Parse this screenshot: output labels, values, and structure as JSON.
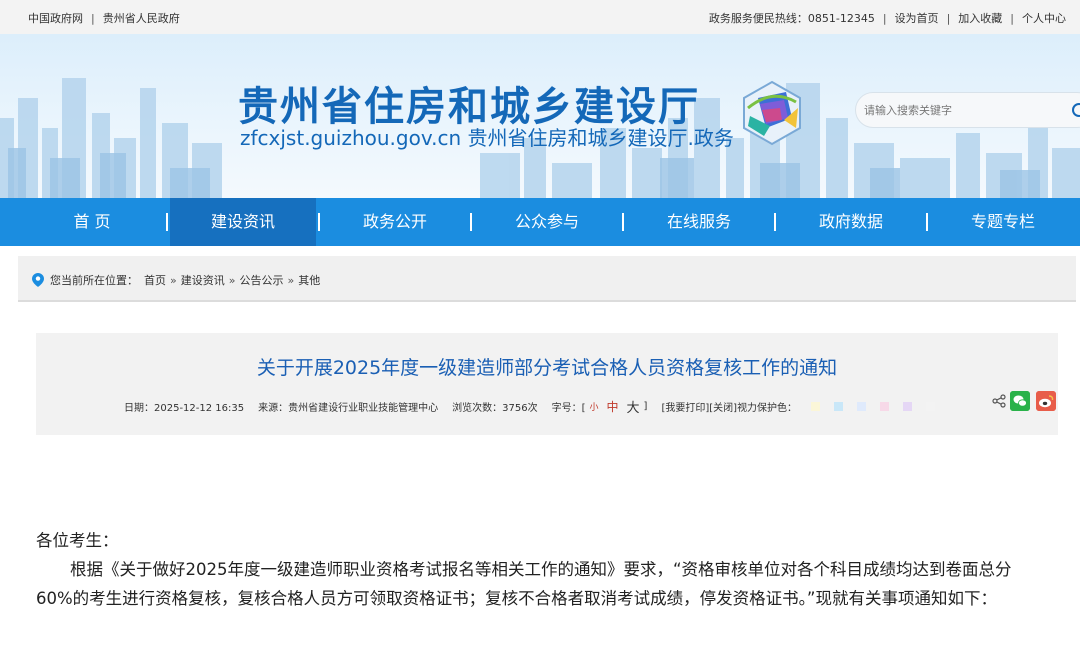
{
  "topbar": {
    "links_left": [
      "中国政府网",
      "贵州省人民政府"
    ],
    "hotline_label": "政务服务便民热线：",
    "hotline_number": "0851-12345",
    "links_right": [
      "设为首页",
      "加入收藏",
      "个人中心"
    ]
  },
  "banner": {
    "title": "贵州省住房和城乡建设厅",
    "subtitle": "zfcxjst.guizhou.gov.cn 贵州省住房和城乡建设厅.政务"
  },
  "search": {
    "placeholder": "请输入搜索关键字"
  },
  "nav": {
    "items": [
      "首 页",
      "建设资讯",
      "政务公开",
      "公众参与",
      "在线服务",
      "政府数据",
      "专题专栏"
    ],
    "active_index": 1
  },
  "breadcrumb": {
    "label": "您当前所在位置：",
    "items": [
      "首页",
      "建设资讯",
      "公告公示",
      "其他"
    ]
  },
  "article": {
    "title": "关于开展2025年度一级建造师部分考试合格人员资格复核工作的通知",
    "date": "日期：2025-12-12 16:35",
    "source": "来源：贵州省建设行业职业技能管理中心",
    "views": "浏览次数：3756次",
    "font_size_label": "字号：[",
    "font_small": "小",
    "font_medium": "中",
    "font_large": "大",
    "font_size_close": "]",
    "print": "[我要打印]",
    "close": "[关闭]",
    "eye_care": "视力保护色：",
    "eye_colors": [
      "#fbf6d8",
      "#c9e7f8",
      "#dfeafc",
      "#f7d9e8",
      "#e5d7f5",
      "#f3f3f3"
    ]
  },
  "body": {
    "greeting": "各位考生：",
    "paragraph": "根据《关于做好2025年度一级建造师职业资格考试报名等相关工作的通知》要求，“资格审核单位对各个科目成绩均达到卷面总分60%的考生进行资格复核，复核合格人员方可领取资格证书；复核不合格者取消考试成绩，停发资格证书。”现就有关事项通知如下："
  },
  "colors": {
    "nav_bg": "#1b8de0",
    "nav_active": "#1670bf",
    "title_blue": "#1468b8"
  }
}
